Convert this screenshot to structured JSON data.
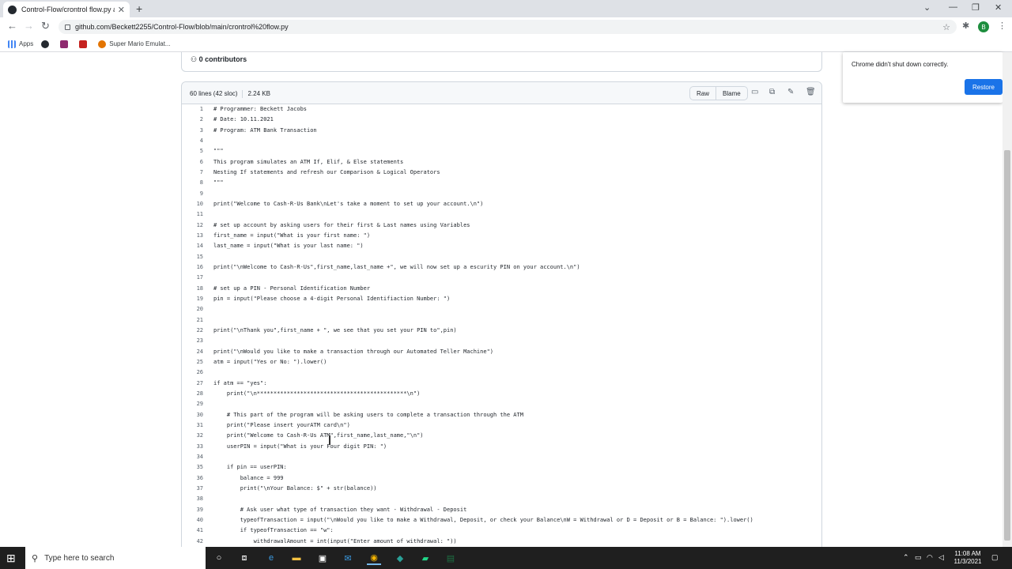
{
  "browser": {
    "tab_title": "Control-Flow/crontrol flow.py at",
    "url": "github.com/Beckett2255/Control-Flow/blob/main/crontrol%20flow.py",
    "avatar_letter": "B",
    "bookmarks": [
      {
        "label": "Apps"
      },
      {
        "label": ""
      },
      {
        "label": ""
      },
      {
        "label": ""
      },
      {
        "label": "Super Mario Emulat..."
      }
    ]
  },
  "file": {
    "contributors": "0 contributors",
    "lines_info": "60 lines (42 sloc)",
    "size": "2.24 KB",
    "raw_label": "Raw",
    "blame_label": "Blame"
  },
  "code_lines": [
    {
      "n": "1",
      "text": "# Programmer: Beckett Jacobs"
    },
    {
      "n": "2",
      "text": "# Date: 10.11.2021"
    },
    {
      "n": "3",
      "text": "# Program: ATM Bank Transaction"
    },
    {
      "n": "4",
      "text": ""
    },
    {
      "n": "5",
      "text": "\"\"\""
    },
    {
      "n": "6",
      "text": "This program simulates an ATM If, Elif, & Else statements"
    },
    {
      "n": "7",
      "text": "Nesting If statements and refresh our Comparison & Logical Operators"
    },
    {
      "n": "8",
      "text": "\"\"\""
    },
    {
      "n": "9",
      "text": ""
    },
    {
      "n": "10",
      "text": "print(\"Welcome to Cash-R-Us Bank\\nLet's take a moment to set up your account.\\n\")"
    },
    {
      "n": "11",
      "text": ""
    },
    {
      "n": "12",
      "text": "# set up account by asking users for their first & Last names using Variables"
    },
    {
      "n": "13",
      "text": "first_name = input(\"What is your first name: \")"
    },
    {
      "n": "14",
      "text": "last_name = input(\"What is your last name: \")"
    },
    {
      "n": "15",
      "text": ""
    },
    {
      "n": "16",
      "text": "print(\"\\nWelcome to Cash-R-Us\",first_name,last_name +\", we will now set up a escurity PIN on your account.\\n\")"
    },
    {
      "n": "17",
      "text": ""
    },
    {
      "n": "18",
      "text": "# set up a PIN - Personal Identification Number"
    },
    {
      "n": "19",
      "text": "pin = input(\"Please choose a 4-digit Personal Identifiaction Number: \")"
    },
    {
      "n": "20",
      "text": ""
    },
    {
      "n": "21",
      "text": ""
    },
    {
      "n": "22",
      "text": "print(\"\\nThank you\",first_name + \", we see that you set your PIN to\",pin)"
    },
    {
      "n": "23",
      "text": ""
    },
    {
      "n": "24",
      "text": "print(\"\\nWould you like to make a transaction through our Automated Teller Machine\")"
    },
    {
      "n": "25",
      "text": "atm = input(\"Yes or No: \").lower()"
    },
    {
      "n": "26",
      "text": ""
    },
    {
      "n": "27",
      "text": "if atm == \"yes\":"
    },
    {
      "n": "28",
      "text": "    print(\"\\n*********************************************\\n\")"
    },
    {
      "n": "29",
      "text": ""
    },
    {
      "n": "30",
      "text": "    # This part of the program will be asking users to complete a transaction through the ATM"
    },
    {
      "n": "31",
      "text": "    print(\"Please insert yourATM card\\n\")"
    },
    {
      "n": "32",
      "text": "    print(\"Welcome to Cash-R-Us ATM\",first_name,last_name,\"\\n\")"
    },
    {
      "n": "33",
      "text": "    userPIN = input(\"What is your Four digit PIN: \")"
    },
    {
      "n": "34",
      "text": ""
    },
    {
      "n": "35",
      "text": "    if pin == userPIN:"
    },
    {
      "n": "36",
      "text": "        balance = 999"
    },
    {
      "n": "37",
      "text": "        print(\"\\nYour Balance: $\" + str(balance))"
    },
    {
      "n": "38",
      "text": ""
    },
    {
      "n": "39",
      "text": "        # Ask user what type of transaction they want - Withdrawal - Deposit"
    },
    {
      "n": "40",
      "text": "        typeofTransaction = input(\"\\nWould you like to make a Withdrawal, Deposit, or check your Balance\\nW = Withdrawal or D = Deposit or B = Balance: \").lower()"
    },
    {
      "n": "41",
      "text": "        if typeofTransaction == \"w\":"
    },
    {
      "n": "42",
      "text": "            withdrawalAmount = int(input(\"Enter amount of withdrawal: \"))"
    }
  ],
  "notification": {
    "message": "Chrome didn't shut down correctly.",
    "restore_label": "Restore"
  },
  "taskbar": {
    "search_placeholder": "Type here to search",
    "time": "11:08 AM",
    "date": "11/3/2021"
  },
  "colors": {
    "accent": "#1a73e8",
    "taskbar": "#1f1f1f"
  }
}
